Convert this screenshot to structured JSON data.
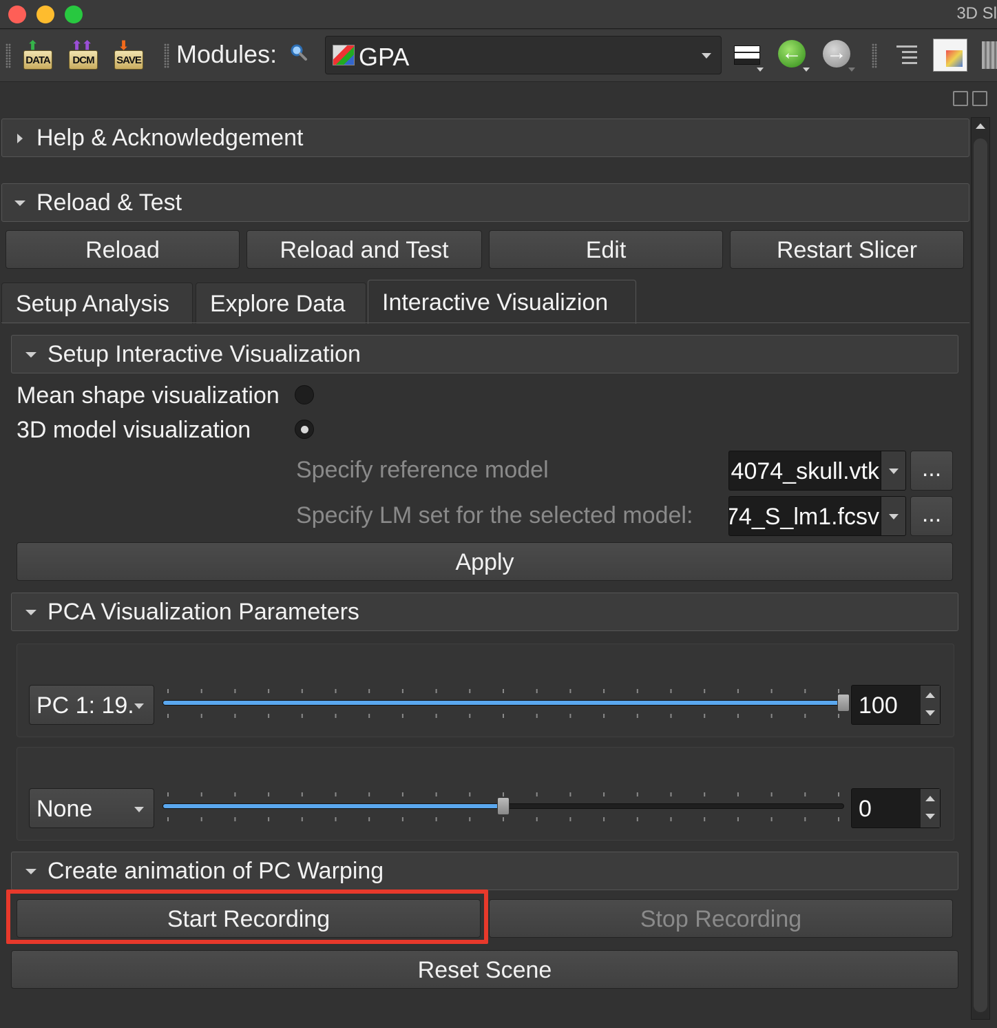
{
  "window": {
    "title": "3D Sl"
  },
  "toolbar": {
    "data_label": "DATA",
    "dcm_label": "DCM",
    "save_label": "SAVE",
    "modules_label": "Modules:",
    "module_value": "GPA"
  },
  "sections": {
    "help": "Help & Acknowledgement",
    "reload": "Reload & Test"
  },
  "reload_buttons": {
    "reload": "Reload",
    "reload_and_test": "Reload and Test",
    "edit": "Edit",
    "restart": "Restart Slicer"
  },
  "tabs": [
    {
      "label": "Setup Analysis"
    },
    {
      "label": "Explore Data"
    },
    {
      "label": "Interactive Visualizion"
    }
  ],
  "setup_viz": {
    "header": "Setup Interactive Visualization",
    "mean_shape_label": "Mean shape visualization",
    "model_label": "3D model visualization",
    "ref_model_label": "Specify reference model",
    "ref_model_value": "4074_skull.vtk",
    "lm_label": "Specify LM set for the selected model:",
    "lm_value": "74_S_lm1.fcsv",
    "browse": "...",
    "apply": "Apply"
  },
  "pca": {
    "header": "PCA Visualization Parameters",
    "pc1_select": "PC 1: 19.",
    "pc1_value": "100",
    "pc1_fraction": 1.0,
    "pc2_select": "None",
    "pc2_value": "0",
    "pc2_fraction": 0.5
  },
  "animation": {
    "header": "Create animation of PC Warping",
    "start": "Start Recording",
    "stop": "Stop Recording",
    "reset": "Reset Scene"
  },
  "colors": {
    "highlight": "#e8392b",
    "slider_fill": "#5aa7ee",
    "background": "#323232"
  }
}
